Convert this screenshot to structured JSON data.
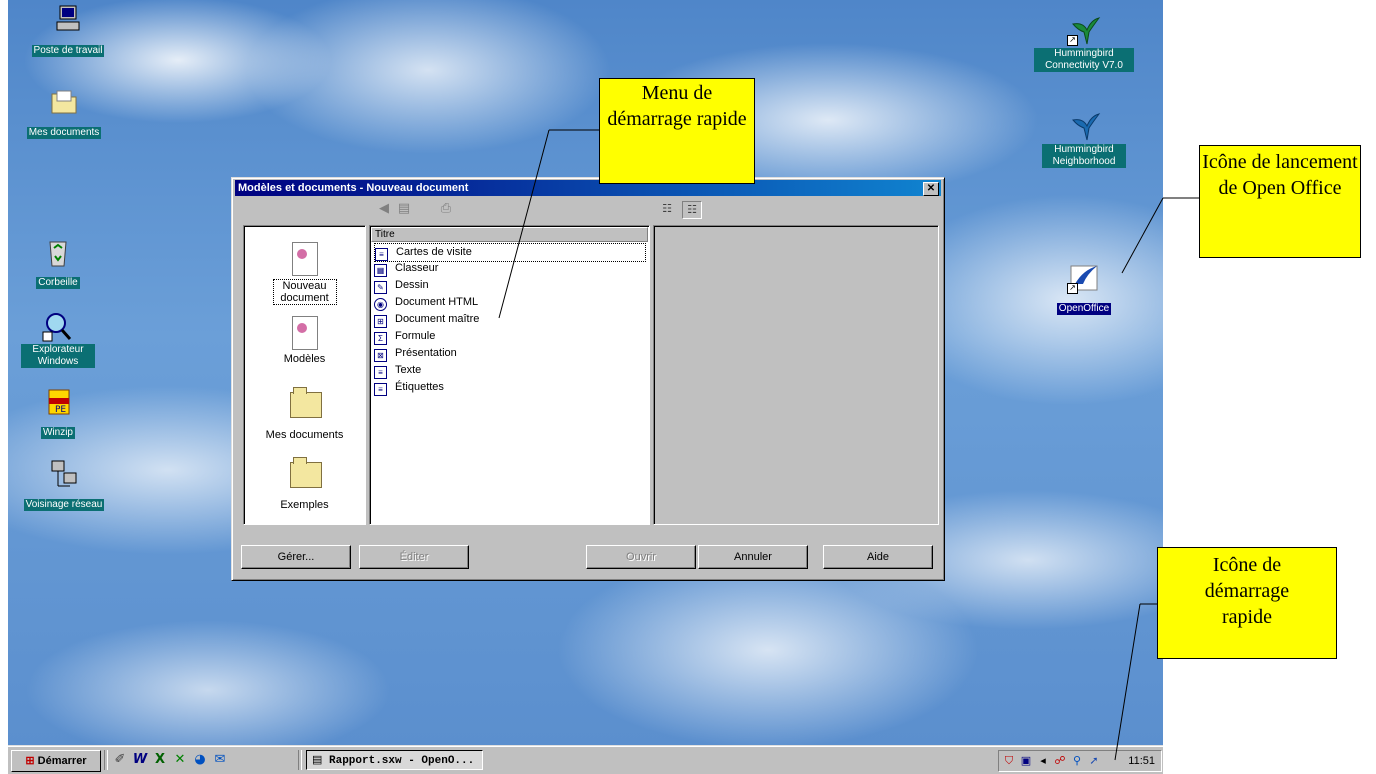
{
  "desktop": {
    "icons_left": [
      {
        "label": "Poste de travail",
        "icon": "computer-icon"
      },
      {
        "label": "Mes documents",
        "icon": "folder-icon"
      },
      {
        "label": "Corbeille",
        "icon": "recycle-bin-icon"
      },
      {
        "label": "Explorateur Windows",
        "icon": "explorer-icon"
      },
      {
        "label": "Winzip",
        "icon": "winzip-icon"
      },
      {
        "label": "Voisinage réseau",
        "icon": "network-icon"
      }
    ],
    "icons_right": [
      {
        "label": "Hummingbird Connectivity V7.0",
        "icon": "hummingbird-icon"
      },
      {
        "label": "Hummingbird Neighborhood",
        "icon": "hummingbird-icon"
      },
      {
        "label": "OpenOffice",
        "icon": "openoffice-icon"
      }
    ]
  },
  "dialog": {
    "title": "Modèles et documents - Nouveau document",
    "close_glyph": "✕",
    "categories": [
      {
        "label": "Nouveau document"
      },
      {
        "label": "Modèles"
      },
      {
        "label": "Mes documents"
      },
      {
        "label": "Exemples"
      }
    ],
    "list_header": "Titre",
    "items": [
      "Cartes de visite",
      "Classeur",
      "Dessin",
      "Document HTML",
      "Document maître",
      "Formule",
      "Présentation",
      "Texte",
      "Étiquettes"
    ],
    "buttons": {
      "manage": "Gérer...",
      "edit": "Éditer",
      "open": "Ouvrir",
      "cancel": "Annuler",
      "help": "Aide"
    }
  },
  "taskbar": {
    "start_label": "Démarrer",
    "task_label": "Rapport.sxw - OpenO...",
    "clock": "11:51"
  },
  "callouts": {
    "quickstart_menu": "Menu de démarrage rapide",
    "launch_icon": "Icône de lancement de Open Office",
    "quickstart_icon": "Icône de démarrage rapide"
  },
  "colors": {
    "title_bar": "#000080",
    "callout_fill": "#ffff00",
    "desktop_label_bg": "#0b6f73",
    "window_face": "#c0c0c0"
  }
}
